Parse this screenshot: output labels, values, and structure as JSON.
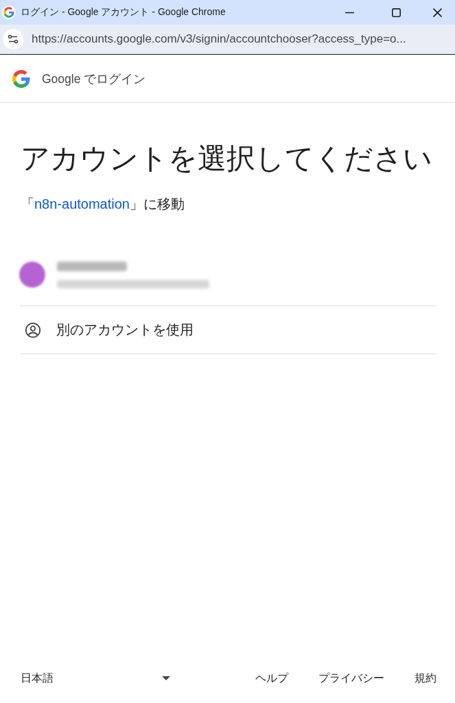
{
  "window": {
    "title": "ログイン - Google アカウント - Google Chrome"
  },
  "address_bar": {
    "url": "https://accounts.google.com/v3/signin/accountchooser?access_type=o..."
  },
  "header": {
    "title": "Google でログイン"
  },
  "main": {
    "heading": "アカウントを選択してください",
    "subtitle": {
      "prefix": "「",
      "link": "n8n-automation",
      "suffix": "」に移動"
    },
    "accounts": [
      {
        "kind": "blurred"
      },
      {
        "kind": "other",
        "label": "別のアカウントを使用"
      }
    ]
  },
  "footer": {
    "language": "日本語",
    "links": [
      "ヘルプ",
      "プライバシー",
      "規約"
    ]
  }
}
